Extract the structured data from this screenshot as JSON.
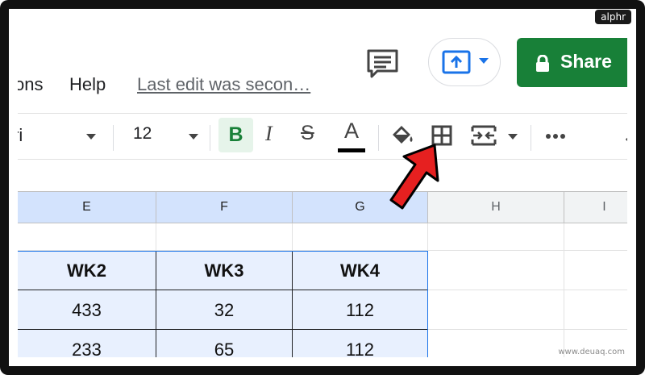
{
  "watermark": {
    "top": "alphr",
    "bottom": "www.deuaq.com"
  },
  "menu": {
    "ext": "ons",
    "help": "Help",
    "last_edit": "Last edit was secon…"
  },
  "share": {
    "label": "Share"
  },
  "toolbar": {
    "font": "ri",
    "size": "12",
    "bold": "B",
    "italic": "I",
    "strike": "S",
    "text_color": "A"
  },
  "columns": [
    "E",
    "F",
    "G",
    "H",
    "I"
  ],
  "rows": [
    [
      "",
      "",
      "",
      "",
      ""
    ],
    [
      "WK2",
      "WK3",
      "WK4",
      "",
      ""
    ],
    [
      "433",
      "32",
      "112",
      "",
      ""
    ],
    [
      "233",
      "65",
      "112",
      "",
      ""
    ]
  ],
  "icons": {
    "comment": "comment-icon",
    "present": "present-upload-icon",
    "share": "lock-icon",
    "fill": "paint-bucket-icon",
    "borders": "borders-icon",
    "merge": "merge-cells-icon",
    "more": "more-horizontal-icon",
    "collapse": "chevron-up-icon"
  },
  "colors": {
    "share_bg": "#188038",
    "bold_bg": "#e6f4ea",
    "selection": "#1a73e8",
    "arrow": "#e62020"
  }
}
